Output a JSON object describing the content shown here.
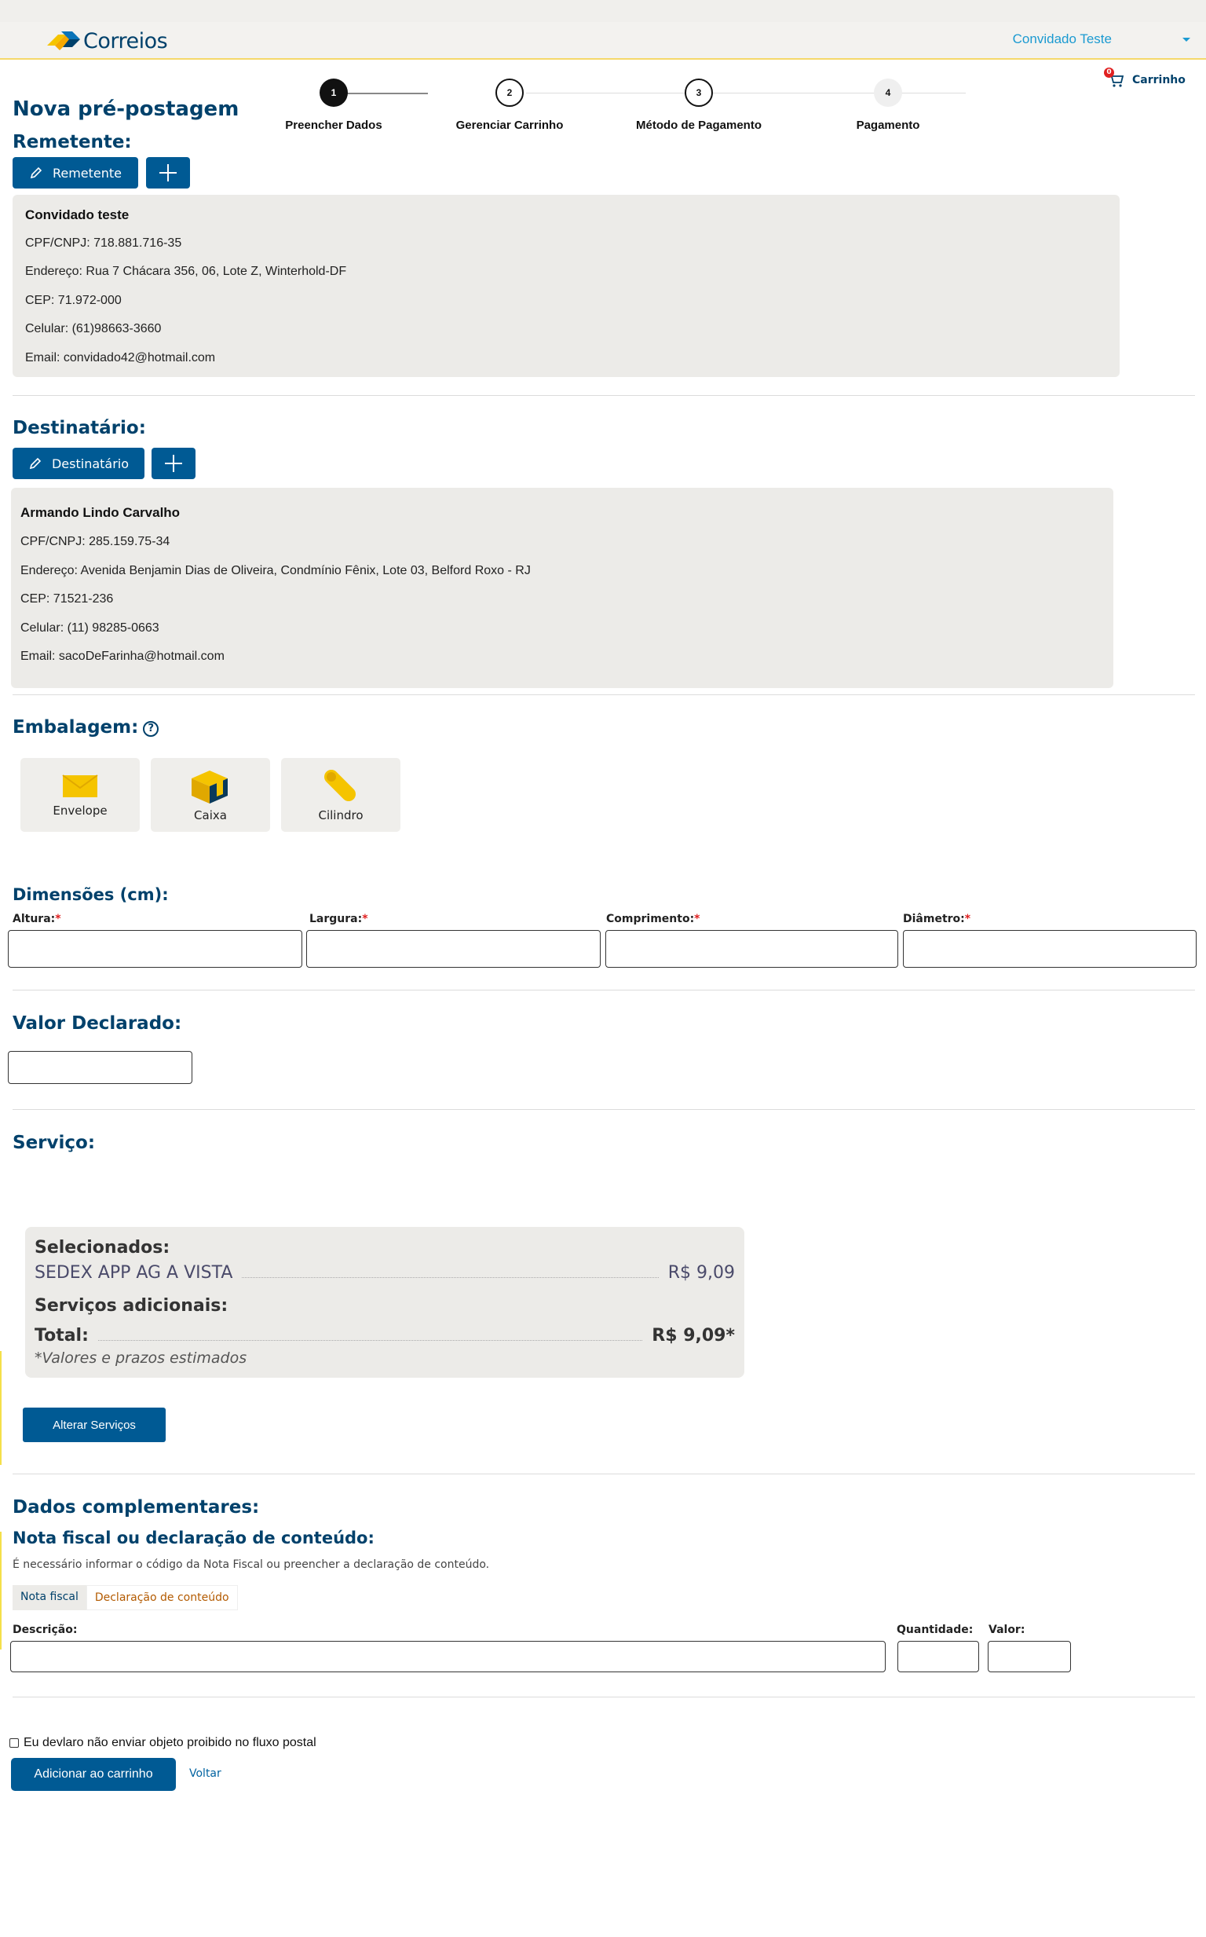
{
  "header": {
    "logo_text": "Correios",
    "user_name": "Convidado Teste"
  },
  "page": {
    "title": "Nova pré-postagem"
  },
  "steps": [
    {
      "number": "1",
      "label": "Preencher Dados",
      "state": "active"
    },
    {
      "number": "2",
      "label": "Gerenciar Carrinho",
      "state": "pending"
    },
    {
      "number": "3",
      "label": "Método de Pagamento",
      "state": "pending"
    },
    {
      "number": "4",
      "label": "Pagamento",
      "state": "disabled"
    }
  ],
  "cart": {
    "label": "Carrinho",
    "count": "0"
  },
  "remetente": {
    "section_title": "Remetente:",
    "edit_button": "Remetente",
    "name": "Convidado teste",
    "cpf": "CPF/CNPJ: 718.881.716-35",
    "endereco": "Endereço: Rua 7 Chácara 356, 06, Lote Z, Winterhold-DF",
    "cep": "CEP: 71.972-000",
    "celular": "Celular: (61)98663-3660",
    "email": "Email: convidado42@hotmail.com"
  },
  "destinatario": {
    "section_title": "Destinatário:",
    "edit_button": "Destinatário",
    "name": "Armando Lindo Carvalho",
    "cpf": "CPF/CNPJ: 285.159.75-34",
    "endereco": "Endereço:  Avenida Benjamin Dias de Oliveira, Condmínio Fênix, Lote 03, Belford Roxo - RJ",
    "cep": "CEP: 71521-236",
    "celular": "Celular: (11) 98285-0663",
    "email": "Email: sacoDeFarinha@hotmail.com"
  },
  "embalagem": {
    "section_title": "Embalagem:",
    "help_glyph": "?",
    "options": [
      "Envelope",
      "Caixa",
      "Cilindro"
    ]
  },
  "dimensoes": {
    "section_title": "Dimensões (cm):",
    "fields": [
      "Altura:",
      "Largura:",
      "Comprimento:",
      "Diâmetro:"
    ],
    "required_mark": "*"
  },
  "valor_declarado": {
    "section_title": "Valor Declarado:"
  },
  "servico": {
    "section_title": "Serviço:",
    "selected_label": "Selecionados:",
    "service_name": "SEDEX APP AG A VISTA",
    "service_price": "R$ 9,09",
    "additional_label": "Serviços adicionais:",
    "total_label": "Total:",
    "total_value": "R$ 9,09*",
    "note": "*Valores e prazos estimados",
    "change_button": "Alterar Serviços"
  },
  "complementares": {
    "section_title": "Dados complementares:",
    "subtitle": "Nota fiscal ou declaração de conteúdo:",
    "info": "É necessário informar o código da Nota Fiscal ou preencher a declaração de conteúdo.",
    "tabs": [
      "Nota fiscal",
      "Declaração de conteúdo"
    ],
    "descricao_label": "Descrição:",
    "quantidade_label": "Quantidade:",
    "valor_label": "Valor:"
  },
  "footer": {
    "checkbox_label": "Eu devlaro não enviar objeto proibido no fluxo postal",
    "add_button": "Adicionar ao carrinho",
    "back_link": "Voltar"
  },
  "colors": {
    "primary": "#005a94",
    "heading": "#00416b",
    "card_bg": "#ecebe8",
    "accent_yellow": "#f5c400"
  }
}
